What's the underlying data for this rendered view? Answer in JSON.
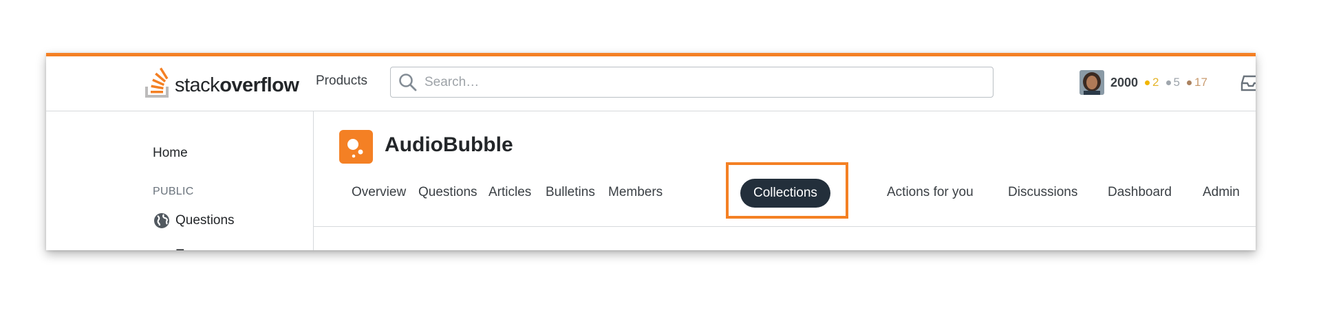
{
  "header": {
    "logo_text_light": "stack",
    "logo_text_bold": "overflow",
    "products_label": "Products",
    "search_placeholder": "Search…"
  },
  "user": {
    "reputation": "2000",
    "gold_badges": "2",
    "silver_badges": "5",
    "bronze_badges": "17"
  },
  "sidebar": {
    "home_label": "Home",
    "section_public": "PUBLIC",
    "questions_label": "Questions",
    "tags_label": "T"
  },
  "team": {
    "name": "AudioBubble"
  },
  "tabs": [
    {
      "label": "Overview"
    },
    {
      "label": "Questions"
    },
    {
      "label": "Articles"
    },
    {
      "label": "Bulletins"
    },
    {
      "label": "Members"
    },
    {
      "label": "Collections"
    },
    {
      "label": "Actions for you"
    },
    {
      "label": "Discussions"
    },
    {
      "label": "Dashboard"
    },
    {
      "label": "Admin"
    }
  ],
  "colors": {
    "accent": "#f48024",
    "active_tab_bg": "#232f3b",
    "gold": "#f1b600",
    "silver": "#9fa6ad",
    "bronze": "#ab825f"
  },
  "icons": {
    "search": "search-icon",
    "globe": "globe-icon",
    "inbox": "inbox-icon",
    "logo": "stackoverflow-logo-icon"
  }
}
